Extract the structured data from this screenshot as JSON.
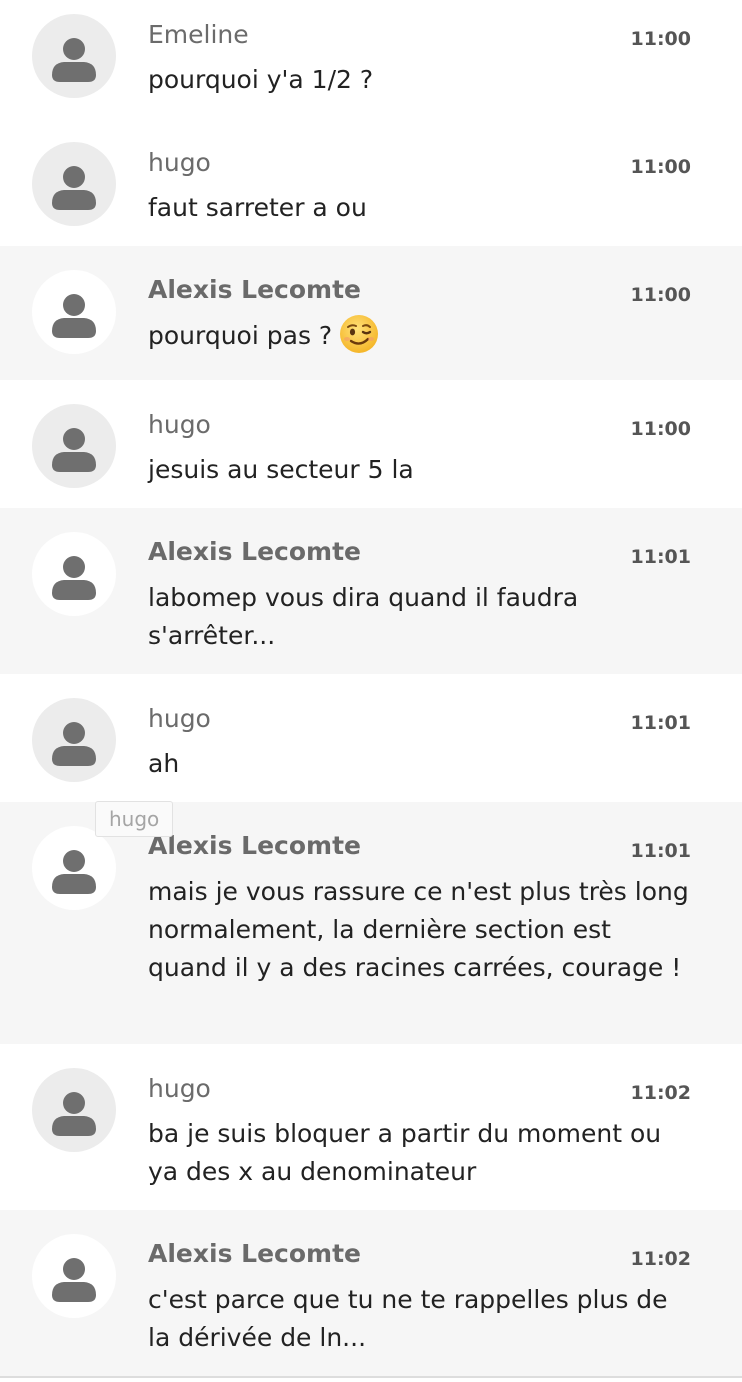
{
  "messages": [
    {
      "author": "Emeline",
      "time": "11:00",
      "text": "pourquoi y'a 1/2 ?",
      "avatar_icon": "user-icon"
    },
    {
      "author": "hugo",
      "time": "11:00",
      "text": "faut sarreter a  ou",
      "avatar_icon": "user-icon"
    },
    {
      "author": "Alexis Lecomte",
      "time": "11:00",
      "text": "pourquoi pas ?",
      "emoji": "winking-face",
      "avatar_icon": "user-icon"
    },
    {
      "author": "hugo",
      "time": "11:00",
      "text": "jesuis au secteur 5 la",
      "avatar_icon": "user-icon"
    },
    {
      "author": "Alexis Lecomte",
      "time": "11:01",
      "text": "labomep vous dira quand il faudra s'arrêter...",
      "avatar_icon": "user-icon"
    },
    {
      "author": "hugo",
      "time": "11:01",
      "text": "ah",
      "avatar_icon": "user-icon"
    },
    {
      "author": "Alexis Lecomte",
      "time": "11:01",
      "text": "mais je vous rassure ce n'est plus très long normalement, la dernière section est quand il y a des racines carrées, courage !",
      "avatar_icon": "user-icon"
    },
    {
      "author": "hugo",
      "time": "11:02",
      "text": "ba je suis bloquer a partir du moment ou ya des x au denominateur",
      "avatar_icon": "user-icon"
    },
    {
      "author": "Alexis Lecomte",
      "time": "11:02",
      "text": "c'est parce que tu ne te rappelles plus de la dérivée de ln...",
      "avatar_icon": "user-icon"
    }
  ],
  "tooltip": {
    "text": "hugo"
  },
  "colors": {
    "alt_row_bg": "#f6f6f6",
    "avatar_icon": "#6f6f6f",
    "text": "#222222",
    "author": "#6b6b6b"
  }
}
